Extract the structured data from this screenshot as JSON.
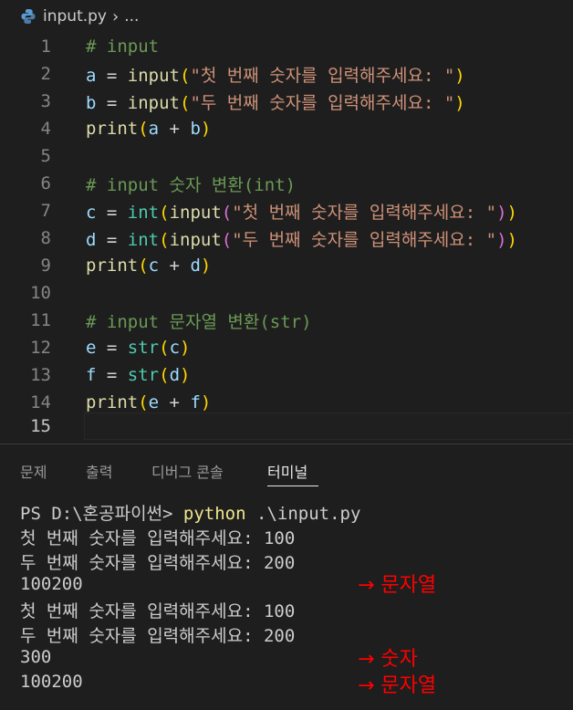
{
  "breadcrumb": {
    "file": "input.py",
    "chevron": "›",
    "ellipsis": "..."
  },
  "editor": {
    "lines": [
      {
        "num": "1"
      },
      {
        "num": "2"
      },
      {
        "num": "3"
      },
      {
        "num": "4"
      },
      {
        "num": "5"
      },
      {
        "num": "6"
      },
      {
        "num": "7"
      },
      {
        "num": "8"
      },
      {
        "num": "9"
      },
      {
        "num": "10"
      },
      {
        "num": "11"
      },
      {
        "num": "12"
      },
      {
        "num": "13"
      },
      {
        "num": "14"
      },
      {
        "num": "15"
      }
    ],
    "tokens": {
      "l1_comment": "# input",
      "l2_var": "a",
      "l2_eq": " = ",
      "l2_fn": "input",
      "l2_open": "(",
      "l2_str": "\"첫 번째 숫자를 입력해주세요: \"",
      "l2_close": ")",
      "l3_var": "b",
      "l3_eq": " = ",
      "l3_fn": "input",
      "l3_open": "(",
      "l3_str": "\"두 번째 숫자를 입력해주세요: \"",
      "l3_close": ")",
      "l4_fn": "print",
      "l4_open": "(",
      "l4_a": "a",
      "l4_op": " + ",
      "l4_b": "b",
      "l4_close": ")",
      "l6_comment": "# input 숫자 변환(int)",
      "l7_var": "c",
      "l7_eq": " = ",
      "l7_type": "int",
      "l7_open1": "(",
      "l7_fn": "input",
      "l7_open2": "(",
      "l7_str": "\"첫 번째 숫자를 입력해주세요: \"",
      "l7_close2": ")",
      "l7_close1": ")",
      "l8_var": "d",
      "l8_eq": " = ",
      "l8_type": "int",
      "l8_open1": "(",
      "l8_fn": "input",
      "l8_open2": "(",
      "l8_str": "\"두 번째 숫자를 입력해주세요: \"",
      "l8_close2": ")",
      "l8_close1": ")",
      "l9_fn": "print",
      "l9_open": "(",
      "l9_a": "c",
      "l9_op": " + ",
      "l9_b": "d",
      "l9_close": ")",
      "l11_comment": "# input 문자열 변환(str)",
      "l12_var": "e",
      "l12_eq": " = ",
      "l12_type": "str",
      "l12_open": "(",
      "l12_arg": "c",
      "l12_close": ")",
      "l13_var": "f",
      "l13_eq": " = ",
      "l13_type": "str",
      "l13_open": "(",
      "l13_arg": "d",
      "l13_close": ")",
      "l14_fn": "print",
      "l14_open": "(",
      "l14_a": "e",
      "l14_op": " + ",
      "l14_b": "f",
      "l14_close": ")"
    }
  },
  "panel": {
    "tabs": [
      "문제",
      "출력",
      "디버그 콘솔",
      "터미널"
    ],
    "active_tab": "터미널"
  },
  "terminal": {
    "prompt": "PS D:\\혼공파이썬> ",
    "command": "python",
    "args": " .\\input.py",
    "output": [
      "첫 번째 숫자를 입력해주세요: 100",
      "두 번째 숫자를 입력해주세요: 200",
      "100200",
      "첫 번째 숫자를 입력해주세요: 100",
      "두 번째 숫자를 입력해주세요: 200",
      "300",
      "100200"
    ]
  },
  "annotations": [
    "→ 문자열",
    "→ 숫자",
    "→ 문자열"
  ],
  "colors": {
    "background": "#1e1e1e",
    "comment": "#6a9955",
    "string": "#ce9178",
    "function": "#dcdcaa",
    "variable": "#9cdcfe",
    "builtin_type": "#4ec9b0",
    "annotation": "#ff0000"
  }
}
